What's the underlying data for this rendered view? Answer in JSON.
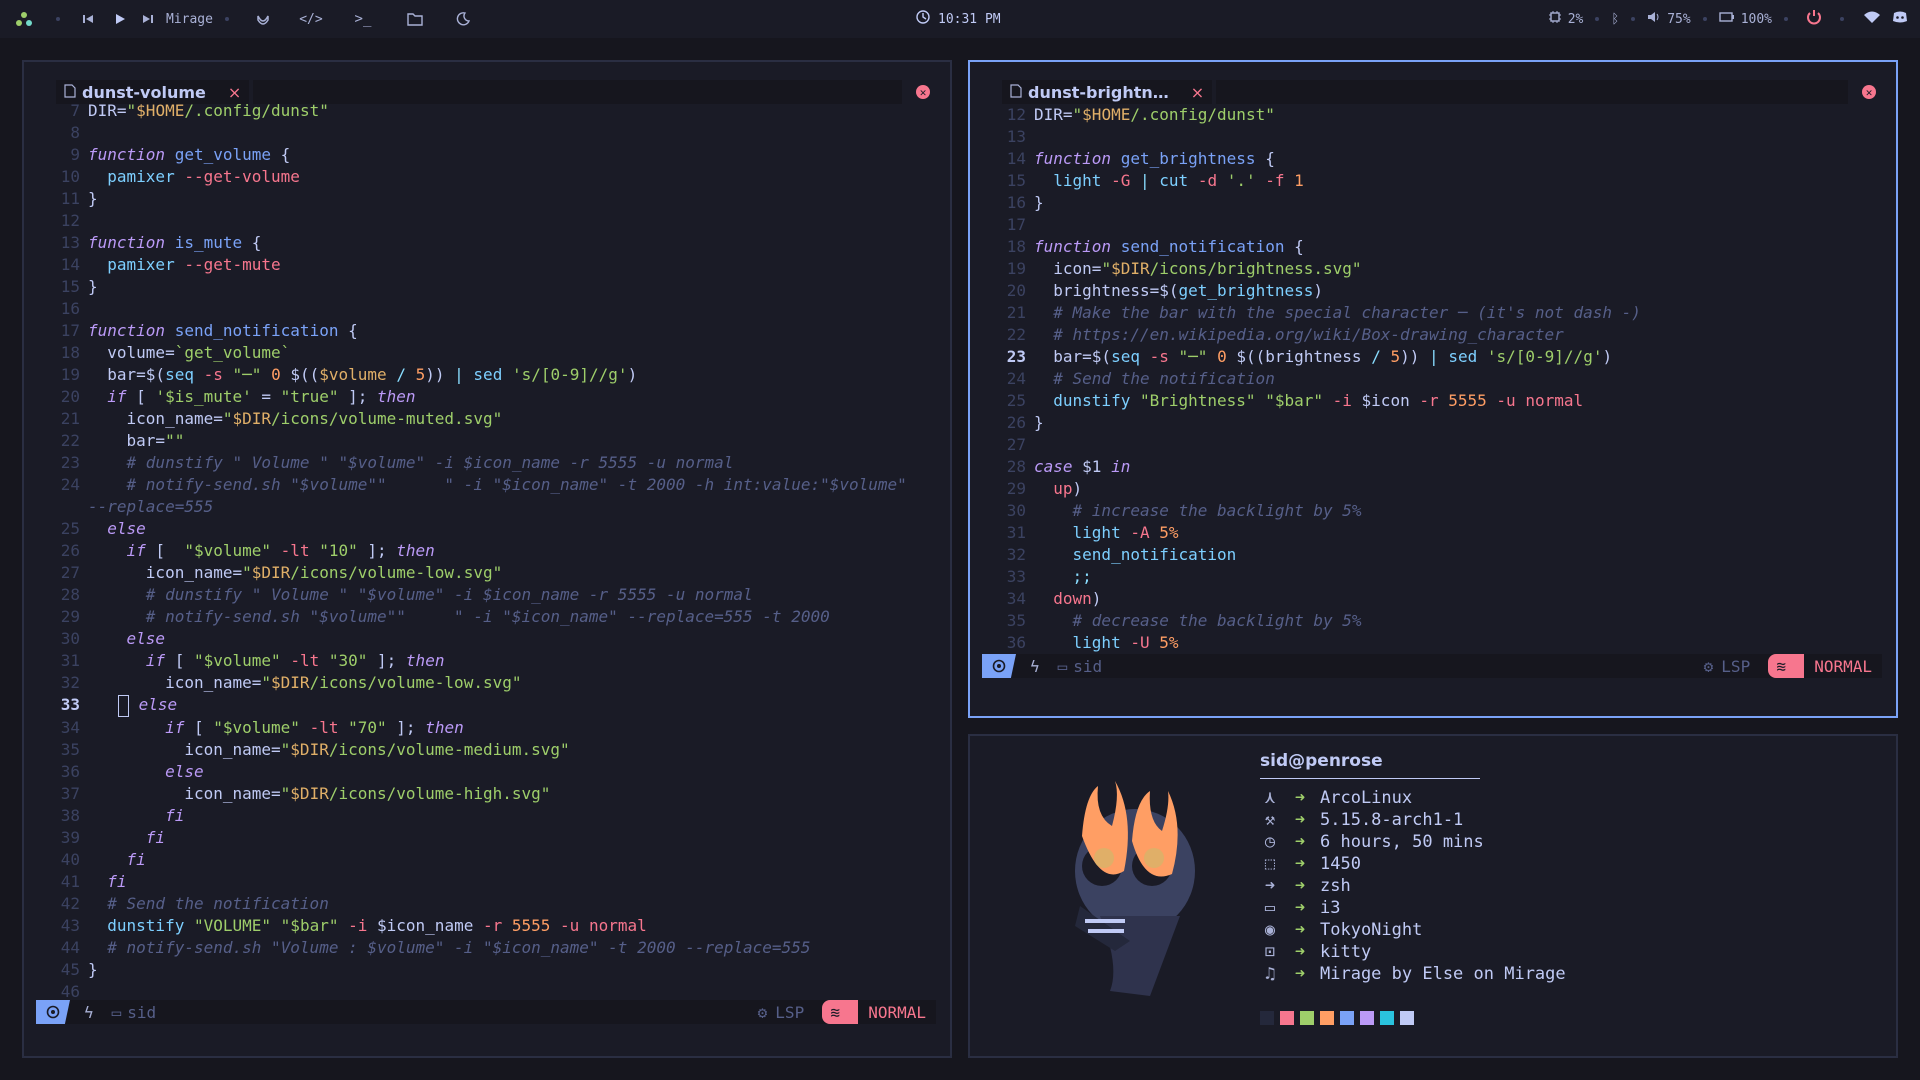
{
  "topbar": {
    "player_title": "Mirage",
    "clock": "10:31 PM",
    "cpu": "2%",
    "volume": "75%",
    "battery": "100%"
  },
  "left_editor": {
    "tab_title": "dunst-volume",
    "tab_close": "×",
    "lines": [
      {
        "n": "7",
        "h": "DIR=<span class=str>\"<span class=var>$HOME</span>/.config/dunst\"</span>"
      },
      {
        "n": "8",
        "h": ""
      },
      {
        "n": "9",
        "h": "<span class=kw>function</span> <span class=fn>get_volume</span> {"
      },
      {
        "n": "10",
        "h": "  <span class=cmd>pamixer</span> <span class=flag>--get-volume</span>"
      },
      {
        "n": "11",
        "h": "}"
      },
      {
        "n": "12",
        "h": ""
      },
      {
        "n": "13",
        "h": "<span class=kw>function</span> <span class=fn>is_mute</span> {"
      },
      {
        "n": "14",
        "h": "  <span class=cmd>pamixer</span> <span class=flag>--get-mute</span>"
      },
      {
        "n": "15",
        "h": "}"
      },
      {
        "n": "16",
        "h": ""
      },
      {
        "n": "17",
        "h": "<span class=kw>function</span> <span class=fn>send_notification</span> {"
      },
      {
        "n": "18",
        "h": "  volume=<span class=str>`get_volume`</span>"
      },
      {
        "n": "19",
        "h": "  bar=$(<span class=cmd>seq</span> <span class=flag>-s</span> <span class=str>\"─\"</span> <span class=num>0</span> $((<span class=var>$volume</span> <span class=op>/</span> <span class=num>5</span>)) <span class=op>|</span> <span class=cmd>sed</span> <span class=str>'s/[0-9]//g'</span>)"
      },
      {
        "n": "20",
        "h": "  <span class=kw>if</span> [ <span class=str>'$is_mute'</span> = <span class=str>\"true\"</span> ]; <span class=kw>then</span>"
      },
      {
        "n": "21",
        "h": "    icon_name=<span class=str>\"<span class=var>$DIR</span>/icons/volume-muted.svg\"</span>"
      },
      {
        "n": "22",
        "h": "    bar=<span class=str>\"\"</span>"
      },
      {
        "n": "23",
        "h": "    <span class=cmt># dunstify \" Volume \" \"$volume\" -i $icon_name -r 5555 -u normal</span>"
      },
      {
        "n": "24",
        "h": "    <span class=cmt># notify-send.sh \"$volume\"\"      \" -i \"$icon_name\" -t 2000 -h int:value:\"$volume\"</span>"
      },
      {
        "n": "",
        "h": "<span class=cmt>--replace=555</span>"
      },
      {
        "n": "25",
        "h": "  <span class=kw>else</span>"
      },
      {
        "n": "26",
        "h": "    <span class=kw>if</span> [  <span class=str>\"$volume\"</span> <span class=flag>-lt</span> <span class=str>\"10\"</span> ]; <span class=kw>then</span>"
      },
      {
        "n": "27",
        "h": "      icon_name=<span class=str>\"<span class=var>$DIR</span>/icons/volume-low.svg\"</span>"
      },
      {
        "n": "28",
        "h": "      <span class=cmt># dunstify \" Volume \" \"$volume\" -i $icon_name -r 5555 -u normal</span>"
      },
      {
        "n": "29",
        "h": "      <span class=cmt># notify-send.sh \"$volume\"\"     \" -i \"$icon_name\" --replace=555 -t 2000</span>"
      },
      {
        "n": "30",
        "h": "    <span class=kw>else</span>"
      },
      {
        "n": "31",
        "h": "      <span class=kw>if</span> [ <span class=str>\"$volume\"</span> <span class=flag>-lt</span> <span class=str>\"30\"</span> ]; <span class=kw>then</span>"
      },
      {
        "n": "32",
        "h": "        icon_name=<span class=str>\"<span class=var>$DIR</span>/icons/volume-low.svg\"</span>"
      },
      {
        "n": "33",
        "h": "      <span class=kw>else</span>",
        "cur": true
      },
      {
        "n": "34",
        "h": "        <span class=kw>if</span> [ <span class=str>\"$volume\"</span> <span class=flag>-lt</span> <span class=str>\"70\"</span> ]; <span class=kw>then</span>"
      },
      {
        "n": "35",
        "h": "          icon_name=<span class=str>\"<span class=var>$DIR</span>/icons/volume-medium.svg\"</span>"
      },
      {
        "n": "36",
        "h": "        <span class=kw>else</span>"
      },
      {
        "n": "37",
        "h": "          icon_name=<span class=str>\"<span class=var>$DIR</span>/icons/volume-high.svg\"</span>"
      },
      {
        "n": "38",
        "h": "        <span class=kw>fi</span>"
      },
      {
        "n": "39",
        "h": "      <span class=kw>fi</span>"
      },
      {
        "n": "40",
        "h": "    <span class=kw>fi</span>"
      },
      {
        "n": "41",
        "h": "  <span class=kw>fi</span>"
      },
      {
        "n": "42",
        "h": "  <span class=cmt># Send the notification</span>"
      },
      {
        "n": "43",
        "h": "  <span class=cmd>dunstify</span> <span class=str>\"VOLUME\"</span> <span class=str>\"$bar\"</span> <span class=flag>-i</span> $icon_name <span class=flag>-r</span> <span class=num>5555</span> <span class=flag>-u</span> <span class=flag>normal</span>"
      },
      {
        "n": "44",
        "h": "  <span class=cmt># notify-send.sh \"Volume : $volume\" -i \"$icon_name\" -t 2000 --replace=555</span>"
      },
      {
        "n": "45",
        "h": "}"
      },
      {
        "n": "46",
        "h": ""
      }
    ],
    "status": {
      "dir": "sid",
      "lsp": "LSP",
      "mode": "NORMAL"
    }
  },
  "right_editor": {
    "tab_title": "dunst-brightn…",
    "tab_close": "×",
    "lines": [
      {
        "n": "12",
        "h": "DIR=<span class=str>\"<span class=var>$HOME</span>/.config/dunst\"</span>"
      },
      {
        "n": "13",
        "h": ""
      },
      {
        "n": "14",
        "h": "<span class=kw>function</span> <span class=fn>get_brightness</span> {"
      },
      {
        "n": "15",
        "h": "  <span class=cmd>light</span> <span class=flag>-G</span> <span class=op>|</span> <span class=cmd>cut</span> <span class=flag>-d</span> <span class=str>'.'</span> <span class=flag>-f</span> <span class=num>1</span>"
      },
      {
        "n": "16",
        "h": "}"
      },
      {
        "n": "17",
        "h": ""
      },
      {
        "n": "18",
        "h": "<span class=kw>function</span> <span class=fn>send_notification</span> {"
      },
      {
        "n": "19",
        "h": "  icon=<span class=str>\"<span class=var>$DIR</span>/icons/brightness.svg\"</span>"
      },
      {
        "n": "20",
        "h": "  brightness=$(<span class=cmd>get_brightness</span>)"
      },
      {
        "n": "21",
        "h": "  <span class=cmt># Make the bar with the special character ─ (it's not dash -)</span>"
      },
      {
        "n": "22",
        "h": "  <span class=cmt># https://en.wikipedia.org/wiki/Box-drawing_character</span>"
      },
      {
        "n": "23",
        "h": "  bar=$(<span class=cmd>seq</span> <span class=flag>-s</span> <span class=str>\"─\"</span> <span class=num>0</span> $((brightness <span class=op>/</span> <span class=num>5</span>)) <span class=op>|</span> <span class=cmd>sed</span> <span class=str>'s/[0-9]//g'</span>)",
        "cur": true
      },
      {
        "n": "24",
        "h": "  <span class=cmt># Send the notification</span>"
      },
      {
        "n": "25",
        "h": "  <span class=cmd>dunstify</span> <span class=str>\"Brightness\"</span> <span class=str>\"$bar\"</span> <span class=flag>-i</span> $icon <span class=flag>-r</span> <span class=num>5555</span> <span class=flag>-u</span> <span class=flag>normal</span>"
      },
      {
        "n": "26",
        "h": "}"
      },
      {
        "n": "27",
        "h": ""
      },
      {
        "n": "28",
        "h": "<span class=kw>case</span> $1 <span class=kw>in</span>"
      },
      {
        "n": "29",
        "h": "  <span class=flag>up</span>)"
      },
      {
        "n": "30",
        "h": "    <span class=cmt># increase the backlight by 5%</span>"
      },
      {
        "n": "31",
        "h": "    <span class=cmd>light</span> <span class=flag>-A</span> <span class=num>5%</span>"
      },
      {
        "n": "32",
        "h": "    <span class=cmd>send_notification</span>"
      },
      {
        "n": "33",
        "h": "    <span class=op>;;</span>"
      },
      {
        "n": "34",
        "h": "  <span class=flag>down</span>)"
      },
      {
        "n": "35",
        "h": "    <span class=cmt># decrease the backlight by 5%</span>"
      },
      {
        "n": "36",
        "h": "    <span class=cmd>light</span> <span class=flag>-U</span> <span class=num>5%</span>"
      }
    ],
    "status": {
      "dir": "sid",
      "lsp": "LSP",
      "mode": "NORMAL"
    }
  },
  "fetch": {
    "user": "sid@penrose",
    "rows": [
      {
        "icon": "distro-icon",
        "glyph": "⋏",
        "value": "ArcoLinux"
      },
      {
        "icon": "kernel-icon",
        "glyph": "⚒",
        "value": "5.15.8-arch1-1"
      },
      {
        "icon": "uptime-icon",
        "glyph": "◷",
        "value": "6 hours, 50 mins"
      },
      {
        "icon": "packages-icon",
        "glyph": "⬚",
        "value": "1450"
      },
      {
        "icon": "shell-icon",
        "glyph": "➜",
        "value": "zsh"
      },
      {
        "icon": "wm-icon",
        "glyph": "▭",
        "value": "i3"
      },
      {
        "icon": "theme-icon",
        "glyph": "◉",
        "value": "TokyoNight"
      },
      {
        "icon": "terminal-icon",
        "glyph": "⊡",
        "value": "kitty"
      },
      {
        "icon": "music-icon",
        "glyph": "♫",
        "value": "Mirage by Else on Mirage"
      }
    ],
    "swatches": [
      "#24283b",
      "#f7768e",
      "#9ece6a",
      "#ff9e64",
      "#7aa2f7",
      "#bb9af7",
      "#2ac3de",
      "#c0caf5"
    ]
  },
  "colors": {
    "accent": "#7aa2f7",
    "mode": "#f7768e",
    "background": "#1a1b26"
  }
}
